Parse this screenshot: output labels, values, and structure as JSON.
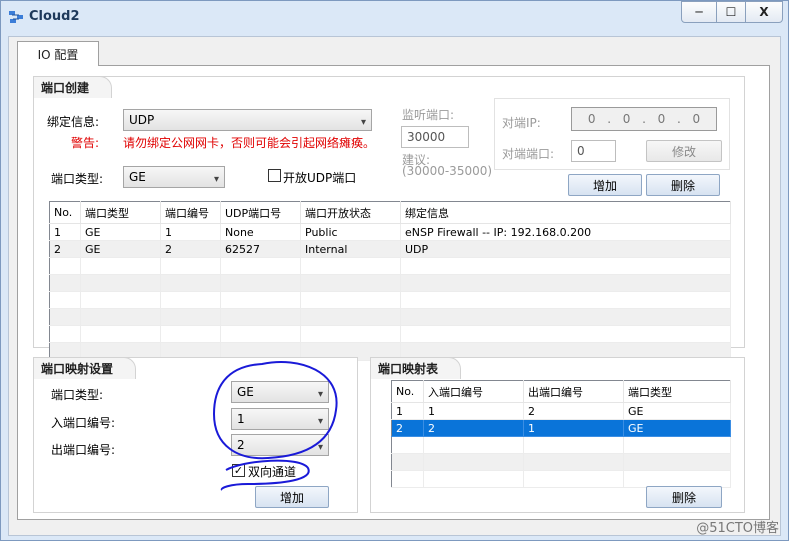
{
  "window": {
    "title": "Cloud2",
    "min": "─",
    "max": "☐",
    "close": "X"
  },
  "tab": {
    "label": "IO 配置"
  },
  "port_create": {
    "title": "端口创建",
    "bind_label": "绑定信息:",
    "bind_value": "UDP",
    "warning_label": "警告:",
    "warning_text": "请勿绑定公网网卡，否则可能会引起网络瘫痪。",
    "port_type_label": "端口类型:",
    "port_type_value": "GE",
    "open_udp_label": "开放UDP端口",
    "listen_label": "监听端口:",
    "listen_value": "30000",
    "suggest_label": "建议:",
    "suggest_range": "(30000-35000)",
    "peer_ip_label": "对端IP:",
    "peer_ip": [
      "0",
      ".",
      "0",
      ".",
      "0",
      ".",
      "0"
    ],
    "peer_port_label": "对端端口:",
    "peer_port_value": "0",
    "modify_label": "修改",
    "add_label": "增加",
    "delete_label": "删除"
  },
  "port_table": {
    "headers": [
      "No.",
      "端口类型",
      "端口编号",
      "UDP端口号",
      "端口开放状态",
      "绑定信息"
    ],
    "rows": [
      [
        "1",
        "GE",
        "1",
        "None",
        "Public",
        "eNSP Firewall -- IP: 192.168.0.200"
      ],
      [
        "2",
        "GE",
        "2",
        "62527",
        "Internal",
        "UDP"
      ]
    ]
  },
  "mapping_settings": {
    "title": "端口映射设置",
    "port_type_label": "端口类型:",
    "port_type_value": "GE",
    "in_port_label": "入端口编号:",
    "in_port_value": "1",
    "out_port_label": "出端口编号:",
    "out_port_value": "2",
    "bidirectional_label": "双向通道",
    "add_label": "增加"
  },
  "mapping_table": {
    "title": "端口映射表",
    "headers": [
      "No.",
      "入端口编号",
      "出端口编号",
      "端口类型"
    ],
    "rows": [
      [
        "1",
        "1",
        "2",
        "GE"
      ],
      [
        "2",
        "2",
        "1",
        "GE"
      ]
    ],
    "delete_label": "删除"
  },
  "watermark": "@51CTO博客",
  "colors": {
    "selection": "#0a74d9",
    "warning": "#e00000",
    "ink": "#1a1ad8"
  }
}
